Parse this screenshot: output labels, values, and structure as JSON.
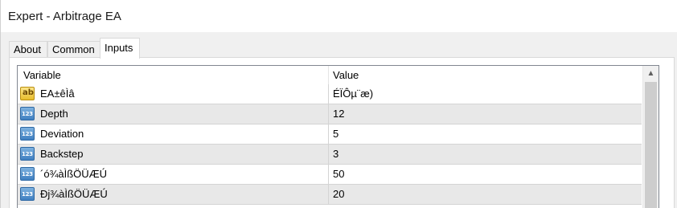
{
  "window": {
    "title": "Expert - Arbitrage EA"
  },
  "tabs": [
    {
      "label": "About"
    },
    {
      "label": "Common"
    },
    {
      "label": "Inputs"
    }
  ],
  "active_tab": "Inputs",
  "grid": {
    "columns": {
      "variable": "Variable",
      "value": "Value"
    },
    "rows": [
      {
        "icon": "string-type-icon",
        "icon_text": "ab",
        "name": "EA±êÌâ",
        "value": "ÉÏÔµ¨æ)"
      },
      {
        "icon": "integer-type-icon",
        "icon_text": "123",
        "name": "Depth",
        "value": "12"
      },
      {
        "icon": "integer-type-icon",
        "icon_text": "123",
        "name": "Deviation",
        "value": "5"
      },
      {
        "icon": "integer-type-icon",
        "icon_text": "123",
        "name": "Backstep",
        "value": "3"
      },
      {
        "icon": "integer-type-icon",
        "icon_text": "123",
        "name": "´ó¾àÌßÖÜÆÚ",
        "value": "50"
      },
      {
        "icon": "integer-type-icon",
        "icon_text": "123",
        "name": "Ðj¾àÌßÖÜÆÚ",
        "value": "20"
      }
    ]
  },
  "scrollbar": {
    "up_arrow": "▲"
  }
}
